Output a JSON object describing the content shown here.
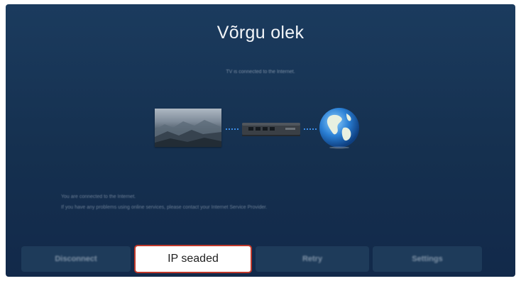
{
  "screen": {
    "title": "Võrgu olek",
    "status_message": "TV is connected to the Internet."
  },
  "diagram": {
    "devices": [
      "tv-image",
      "router-icon",
      "globe-icon"
    ],
    "connection_color": "#3d8ee8"
  },
  "info": {
    "line1": "You are connected to the Internet.",
    "line2": "If you have any problems using online services, please contact your Internet Service Provider."
  },
  "buttons": [
    {
      "label": "Disconnect",
      "focused": false
    },
    {
      "label": "IP seaded",
      "focused": true
    },
    {
      "label": "Retry",
      "focused": false
    },
    {
      "label": "Settings",
      "focused": false
    }
  ],
  "colors": {
    "background": "#163457",
    "focus_border": "#c0392b"
  }
}
